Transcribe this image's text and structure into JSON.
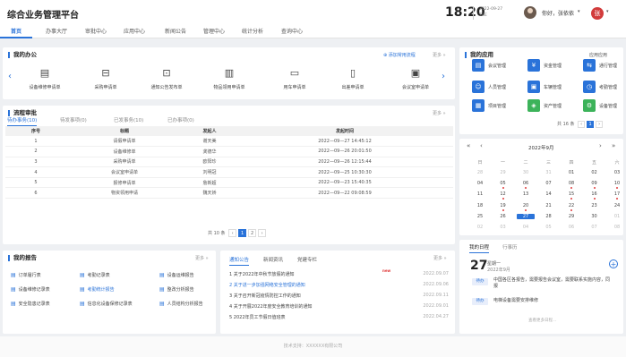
{
  "header": {
    "title": "综合业务管理平台",
    "time": "18:20",
    "date_line1": "2022-09-27",
    "date_line2": "TUE",
    "greeting": "你好，张依依",
    "user_initial": "张"
  },
  "nav": [
    "首页",
    "办事大厅",
    "审批中心",
    "应用中心",
    "新闻公告",
    "管理中心",
    "统计分析",
    "查询中心"
  ],
  "office": {
    "title": "我的办公",
    "add_link": "添加常用流程",
    "more": "更多 »",
    "items": [
      "设备维修申请单",
      "采购申请单",
      "通知公告发布单",
      "物品领用申请单",
      "用车申请单",
      "出差申请单",
      "会议室申请单"
    ]
  },
  "process": {
    "title": "流程审批",
    "more": "更多 »",
    "tabs": [
      "待办事务(10)",
      "待发事项(0)",
      "已发事务(10)",
      "已办事项(0)"
    ],
    "columns": [
      "序号",
      "标题",
      "发起人",
      "发起时间"
    ],
    "rows": [
      [
        "1",
        "请假申请单",
        "谢天美",
        "2022—09—27 14:45:12"
      ],
      [
        "2",
        "设备维修单",
        "龚德华",
        "2022—09—26 20:01:50"
      ],
      [
        "3",
        "采购申请单",
        "欧阳珍",
        "2022—09—26 12:15:44"
      ],
      [
        "4",
        "会议室申请单",
        "刘明冠",
        "2022—09—25 10:30:30"
      ],
      [
        "5",
        "报修申请单",
        "詹新超",
        "2022—09—23 15:40:35"
      ],
      [
        "6",
        "物资领用申请",
        "魏天娇",
        "2022—09—22 09:08:59"
      ]
    ],
    "total": "共 10 条",
    "pages": [
      "1",
      "2"
    ]
  },
  "report": {
    "title": "我的报告",
    "more": "更多 »",
    "items": [
      "订单履行表",
      "考勤记录表",
      "设备运维报告",
      "设备维修记录表",
      "考勤统计报告",
      "整改分析报告",
      "安全隐患记录表",
      "信息化设备保修记录表",
      "人员结构分析报告"
    ]
  },
  "news": {
    "tabs": [
      "通知公告",
      "新闻资讯",
      "党建专栏"
    ],
    "more": "更多 »",
    "new_badge": "new",
    "items": [
      {
        "text": "1 关于2022年中秋节放假的通知",
        "date": "2022.09.07"
      },
      {
        "text": "2 关于进一步加强网络安全管理的通知",
        "date": "2022.09.06"
      },
      {
        "text": "3 关于召开新冠疫情防控工作的通知",
        "date": "2022.09.11"
      },
      {
        "text": "4 关于开展2022年度安全教育培训的通知",
        "date": "2022.09.01"
      },
      {
        "text": "5 2022年员工节假日值班表",
        "date": "2022.04.27"
      }
    ]
  },
  "apps": {
    "title": "我的应用",
    "manage": "应用应用",
    "items": [
      {
        "label": "会议管理",
        "color": "#2a73d9",
        "icon": "meeting-icon",
        "glyph": "▤"
      },
      {
        "label": "资金管理",
        "color": "#2a73d9",
        "icon": "fund-icon",
        "glyph": "¥"
      },
      {
        "label": "通行管理",
        "color": "#2a73d9",
        "icon": "traffic-icon",
        "glyph": "⇆"
      },
      {
        "label": "人员管理",
        "color": "#2a73d9",
        "icon": "person-icon",
        "glyph": "☺"
      },
      {
        "label": "车辆管理",
        "color": "#2a73d9",
        "icon": "car-icon",
        "glyph": "▣"
      },
      {
        "label": "考勤管理",
        "color": "#2a73d9",
        "icon": "attendance-icon",
        "glyph": "◷"
      },
      {
        "label": "项目管理",
        "color": "#2a73d9",
        "icon": "project-icon",
        "glyph": "▦"
      },
      {
        "label": "资产管理",
        "color": "#3cb35a",
        "icon": "asset-icon",
        "glyph": "◈"
      },
      {
        "label": "设备管理",
        "color": "#3cb35a",
        "icon": "device-icon",
        "glyph": "⚙"
      }
    ],
    "total": "共 16 条",
    "page": "1"
  },
  "calendar": {
    "month": "2022年9月",
    "weekdays": [
      "日",
      "一",
      "二",
      "三",
      "四",
      "五",
      "六"
    ],
    "days": [
      "28",
      "29",
      "30",
      "31",
      "01",
      "02",
      "03",
      "04",
      "05",
      "06",
      "07",
      "08",
      "09",
      "10",
      "11",
      "12",
      "13",
      "14",
      "15",
      "16",
      "17",
      "18",
      "19",
      "20",
      "21",
      "22",
      "23",
      "24",
      "25",
      "26",
      "27",
      "28",
      "29",
      "30",
      "01",
      "02",
      "03",
      "04",
      "05",
      "06",
      "07",
      "08"
    ],
    "today_index": 30
  },
  "schedule": {
    "tabs": [
      "我的日程",
      "行事历"
    ],
    "day": "27",
    "weekday": "星期一",
    "month": "2022年9月",
    "items": [
      {
        "tag": "待办",
        "text": "中国各区各报告，需要报告会议室，需要联系实施内容，同报"
      },
      {
        "tag": "待办",
        "text": "电梯设备需要安排维修"
      }
    ],
    "more": "查看更多日程..."
  },
  "footer": "技术支持：XXXXXX有限公司"
}
